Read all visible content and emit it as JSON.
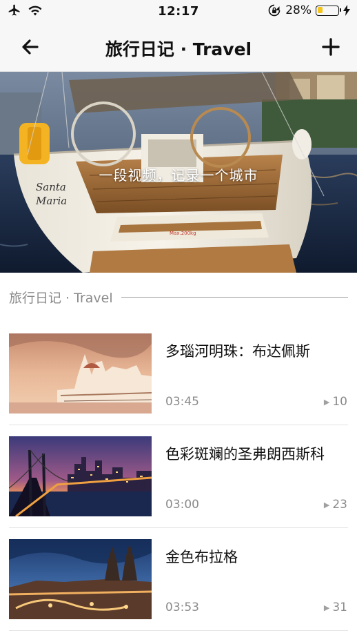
{
  "status_bar": {
    "time": "12:17",
    "battery_percent": "28%",
    "battery_level": 0.28,
    "icons": [
      "airplane-icon",
      "wifi-icon",
      "rotation-lock-icon",
      "battery-icon",
      "charging-bolt-icon"
    ]
  },
  "nav": {
    "title": "旅行日记 · Travel",
    "back_icon": "back-arrow-icon",
    "add_icon": "plus-icon"
  },
  "hero": {
    "caption": "一段视频，记录一个城市"
  },
  "section": {
    "title": "旅行日记 · Travel"
  },
  "videos": [
    {
      "title": "多瑙河明珠：布达佩斯",
      "duration": "03:45",
      "plays": "10"
    },
    {
      "title": "色彩斑斓的圣弗朗西斯科",
      "duration": "03:00",
      "plays": "23"
    },
    {
      "title": "金色布拉格",
      "duration": "03:53",
      "plays": "31"
    }
  ],
  "colors": {
    "bar_background": "#f7f7f7",
    "battery_fill": "#f5c518",
    "secondary_text": "#8a8a8a"
  }
}
